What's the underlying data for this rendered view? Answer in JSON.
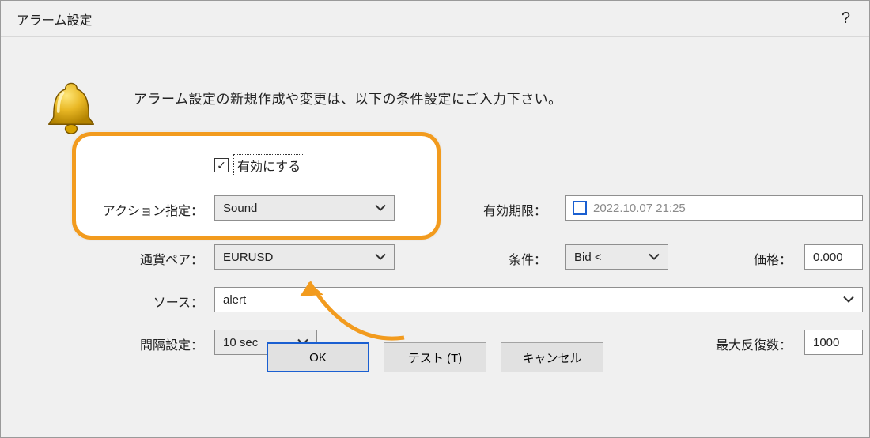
{
  "title": "アラーム設定",
  "help": "?",
  "intro": "アラーム設定の新規作成や変更は、以下の条件設定にご入力下さい。",
  "enable_label": "有効にする",
  "fields": {
    "action": {
      "label": "アクション指定：",
      "value": "Sound"
    },
    "expiry": {
      "label": "有効期限：",
      "value": "2022.10.07 21:25"
    },
    "pair": {
      "label": "通貨ペア：",
      "value": "EURUSD"
    },
    "cond": {
      "label": "条件：",
      "value": "Bid <"
    },
    "price": {
      "label": "価格：",
      "value": "0.000"
    },
    "source": {
      "label": "ソース：",
      "value": "alert"
    },
    "interval": {
      "label": "間隔設定：",
      "value": "10 sec"
    },
    "maxrep": {
      "label": "最大反復数：",
      "value": "1000"
    }
  },
  "buttons": {
    "ok": "OK",
    "test": "テスト (T)",
    "cancel": "キャンセル"
  }
}
